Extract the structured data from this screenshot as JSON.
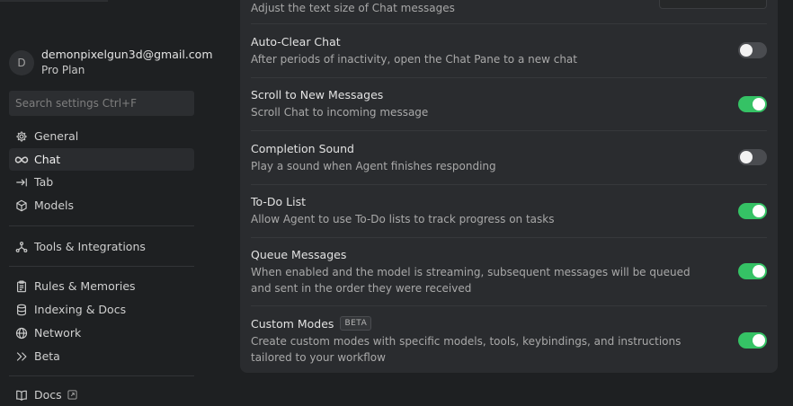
{
  "account": {
    "avatar_letter": "D",
    "email": "demonpixelgun3d@gmail.com",
    "plan": "Pro Plan"
  },
  "search": {
    "placeholder": "Search settings Ctrl+F"
  },
  "sidebar": {
    "items": [
      {
        "label": "General",
        "icon": "gear-icon"
      },
      {
        "label": "Chat",
        "icon": "infinity-icon",
        "active": true
      },
      {
        "label": "Tab",
        "icon": "tab-arrow-icon"
      },
      {
        "label": "Models",
        "icon": "cube-icon"
      },
      {
        "label": "Tools & Integrations",
        "icon": "nodes-icon"
      },
      {
        "label": "Rules & Memories",
        "icon": "clipboard-icon"
      },
      {
        "label": "Indexing & Docs",
        "icon": "database-icon"
      },
      {
        "label": "Network",
        "icon": "globe-icon"
      },
      {
        "label": "Beta",
        "icon": "double-chevron-icon"
      },
      {
        "label": "Docs",
        "icon": "book-icon"
      }
    ]
  },
  "settings": {
    "prev_desc": "Adjust the text size of Chat messages",
    "rows": [
      {
        "title": "Auto-Clear Chat",
        "desc": "After periods of inactivity, open the Chat Pane to a new chat",
        "enabled": false
      },
      {
        "title": "Scroll to New Messages",
        "desc": "Scroll Chat to incoming message",
        "enabled": true
      },
      {
        "title": "Completion Sound",
        "desc": "Play a sound when Agent finishes responding",
        "enabled": false
      },
      {
        "title": "To-Do List",
        "desc": "Allow Agent to use To-Do lists to track progress on tasks",
        "enabled": true
      },
      {
        "title": "Queue Messages",
        "desc": "When enabled and the model is streaming, subsequent messages will be queued and sent in the order they were received",
        "enabled": true
      },
      {
        "title": "Custom Modes",
        "badge": "BETA",
        "desc": "Create custom modes with specific models, tools, keybindings, and instructions tailored to your workflow",
        "enabled": true
      }
    ]
  },
  "colors": {
    "toggle_on": "#35c265",
    "toggle_off": "#4a4c50",
    "background": "#1e2022",
    "panel": "#2a2c2f"
  }
}
